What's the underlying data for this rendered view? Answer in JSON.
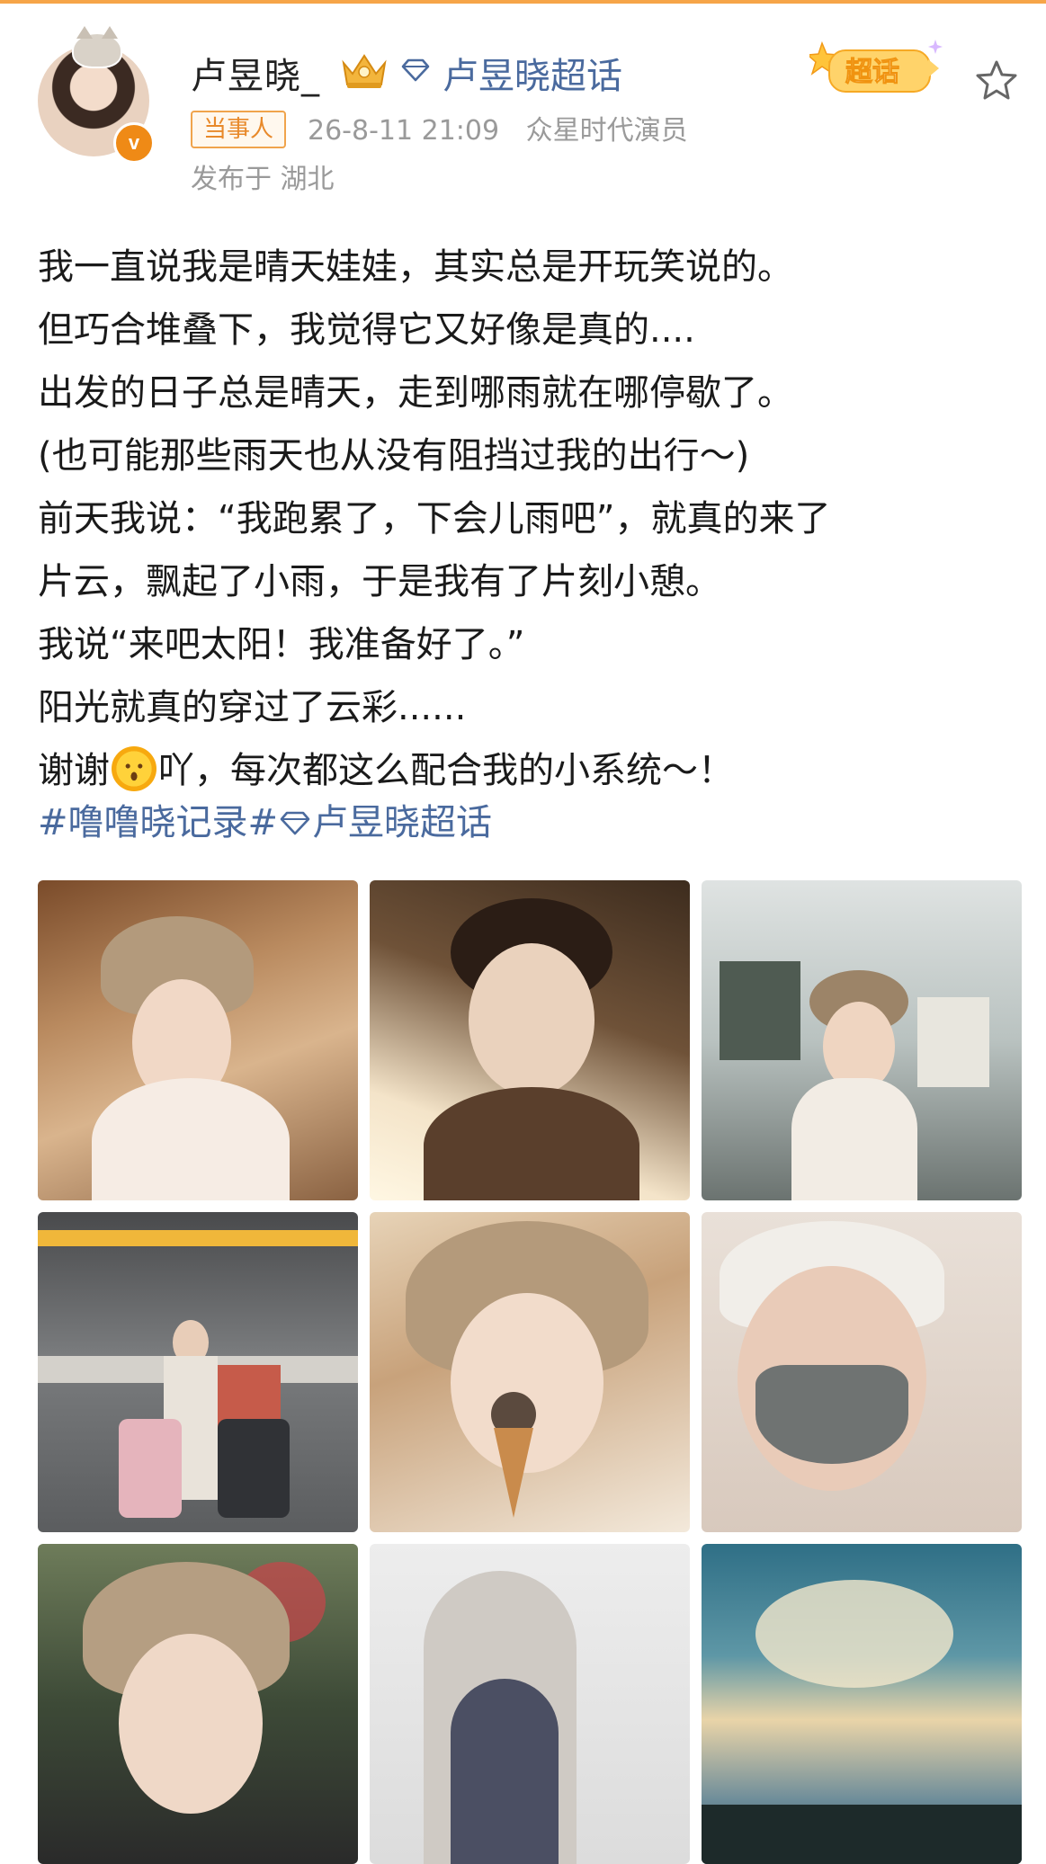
{
  "post": {
    "username": "卢昱晓_",
    "supertopic_link": "卢昱晓超话",
    "supertopic_badge": "超话",
    "party_tag": "当事人",
    "timestamp": "26-8-11 21:09",
    "source": "众星时代演员",
    "location": "发布于 湖北",
    "verified_mark": "v",
    "lines": [
      "我一直说我是晴天娃娃，其实总是开玩笑说的。",
      "但巧合堆叠下，我觉得它又好像是真的....",
      "出发的日子总是晴天，走到哪雨就在哪停歇了。",
      "(也可能那些雨天也从没有阻挡过我的出行～)",
      "前天我说：“我跑累了，下会儿雨吧”，就真的来了",
      "片云，飘起了小雨，于是我有了片刻小憩。",
      "我说“来吧太阳！我准备好了。”",
      "阳光就真的穿过了云彩......"
    ],
    "last_line_before": "谢谢",
    "last_line_after": "吖，每次都这么配合我的小系统～！",
    "hashtag1": "#噜噜晓记录#",
    "hashtag2": "卢昱晓超话"
  },
  "colors": {
    "link": "#4a6a9e",
    "meta": "#9a9a9a",
    "accent_orange": "#ef8a16"
  },
  "icons": [
    "crown-icon",
    "diamond-icon",
    "supertopic-badge-icon",
    "star-icon",
    "verified-badge-icon",
    "sun-emoji-icon"
  ],
  "photos": [
    "photo-bucket-hat-cafe",
    "photo-selfie-backlit",
    "photo-bucket-hat-window",
    "photo-parking-garage-dogs",
    "photo-ice-cream",
    "photo-face-mask",
    "photo-bucket-hat-night",
    "photo-white-arch-interior",
    "photo-cloudy-sky"
  ]
}
